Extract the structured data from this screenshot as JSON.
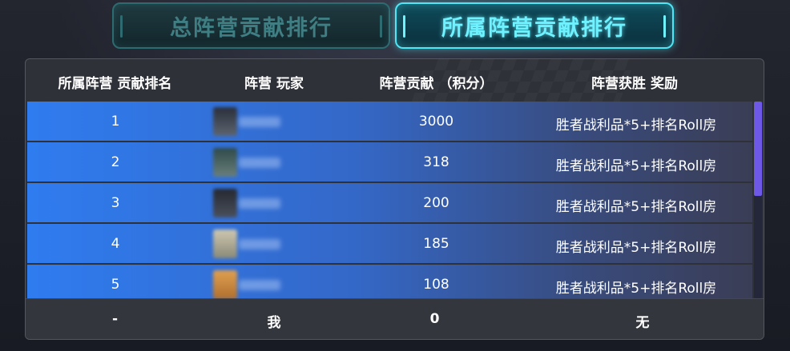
{
  "tabs": [
    {
      "label": "总阵营贡献排行",
      "active": false
    },
    {
      "label": "所属阵营贡献排行",
      "active": true
    }
  ],
  "table": {
    "headers": [
      "所属阵营 贡献排名",
      "阵营 玩家",
      "阵营贡献 （积分）",
      "阵营获胜 奖励"
    ],
    "rows": [
      {
        "rank": "1",
        "score": "3000",
        "reward": "胜者战利品*5+排名Roll房",
        "avatar_colors": [
          "#2a2f3a",
          "#5d6570"
        ]
      },
      {
        "rank": "2",
        "score": "318",
        "reward": "胜者战利品*5+排名Roll房",
        "avatar_colors": [
          "#2f4a4a",
          "#6a7f7a"
        ]
      },
      {
        "rank": "3",
        "score": "200",
        "reward": "胜者战利品*5+排名Roll房",
        "avatar_colors": [
          "#252830",
          "#4a505c"
        ]
      },
      {
        "rank": "4",
        "score": "185",
        "reward": "胜者战利品*5+排名Roll房",
        "avatar_colors": [
          "#cfc8b0",
          "#8a8a78"
        ]
      },
      {
        "rank": "5",
        "score": "108",
        "reward": "胜者战利品*5+排名Roll房",
        "avatar_colors": [
          "#e0a050",
          "#b07030"
        ]
      }
    ],
    "my_row": {
      "rank": "-",
      "player": "我",
      "score": "0",
      "reward": "无"
    }
  },
  "colors": {
    "active_tab_accent": "#4fe6f5",
    "row_gradient_start": "#2f7cf0",
    "scroll_thumb": "#6d58e8"
  }
}
